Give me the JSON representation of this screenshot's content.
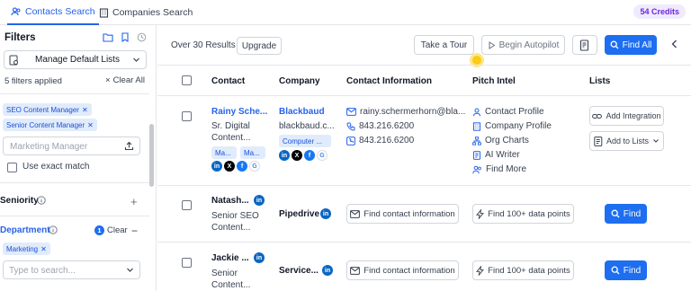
{
  "tabs": [
    {
      "label": "Contacts Search",
      "active": true
    },
    {
      "label": "Companies Search",
      "active": false
    }
  ],
  "credits": "54 Credits",
  "filters": {
    "title": "Filters",
    "manage_lists": "Manage Default Lists",
    "applied": "5 filters applied",
    "clear_all": "Clear All",
    "title_chips": [
      "SEO Content Manager",
      "Senior Content Manager"
    ],
    "title_placeholder": "Marketing Manager",
    "exact_match": "Use exact match",
    "seniority": "Seniority",
    "department": "Department",
    "department_count": "1",
    "department_clear": "Clear",
    "department_chip": "Marketing",
    "department_placeholder": "Type to search..."
  },
  "toolbar": {
    "results": "Over 30 Results",
    "upgrade": "Upgrade",
    "tour": "Take a Tour",
    "autopilot": "Begin Autopilot",
    "find_all": "Find All"
  },
  "columns": {
    "contact": "Contact",
    "company": "Company",
    "contact_info": "Contact Information",
    "pitch_intel": "Pitch Intel",
    "lists": "Lists"
  },
  "rows": [
    {
      "name": "Rainy Sche...",
      "title1": "Sr. Digital",
      "title2": "Content...",
      "chip1": "Ma...",
      "chip2": "Ma...",
      "company": "Blackbaud",
      "company_domain": "blackbaud.c...",
      "company_chip": "Computer ...",
      "email": "rainy.schermerhorn@bla...",
      "phone1": "843.216.6200",
      "phone2": "843.216.6200",
      "intel": [
        "Contact Profile",
        "Company Profile",
        "Org Charts",
        "AI Writer",
        "Find More"
      ],
      "add_integration": "Add Integration",
      "add_to_lists": "Add to Lists"
    },
    {
      "name": "Natash...",
      "title1": "Senior SEO",
      "title2": "Content...",
      "company": "Pipedrive",
      "find_contact": "Find contact information",
      "find_data": "Find 100+ data points",
      "find": "Find"
    },
    {
      "name": "Jackie ...",
      "title1": "Senior",
      "title2": "Content...",
      "company": "Service...",
      "find_contact": "Find contact information",
      "find_data": "Find 100+ data points",
      "find": "Find"
    }
  ],
  "social": {
    "linkedin": "in",
    "x": "X",
    "facebook": "f",
    "google": "G"
  },
  "colors": {
    "accent": "#1d6ef0",
    "link": "#2563eb",
    "credits_bg": "#efeafd",
    "credits_text": "#6d28d9"
  }
}
